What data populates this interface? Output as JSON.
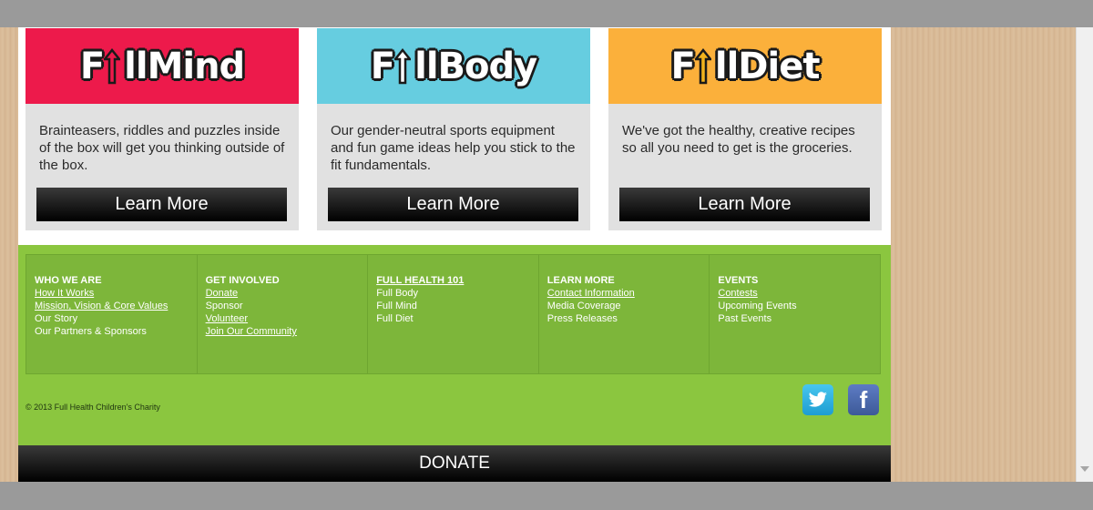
{
  "cards": [
    {
      "logo": "FullMind",
      "logo_prefix": "F",
      "logo_ll": "ll",
      "logo_suffix": "Mind",
      "head_color": "#ed1a4b",
      "arrow_color": "#ed1a4b",
      "text": "Brainteasers, riddles and puzzles inside of the box will get you thinking outside of the box.",
      "button": "Learn More"
    },
    {
      "logo": "FullBody",
      "logo_prefix": "F",
      "logo_ll": "ll",
      "logo_suffix": "Body",
      "head_color": "#66cde0",
      "arrow_color": "#66cde0",
      "text": "Our gender-neutral sports equipment and fun game ideas help you stick to the fit fundamentals.",
      "button": "Learn More"
    },
    {
      "logo": "FullDiet",
      "logo_prefix": "F",
      "logo_ll": "ll",
      "logo_suffix": "Diet",
      "head_color": "#fbb03b",
      "arrow_color": "#f2b31c",
      "text": "We've got the healthy, creative recipes so all you need to get is the groceries.",
      "button": "Learn More"
    }
  ],
  "footer": {
    "columns": [
      {
        "heading": "WHO WE ARE",
        "heading_link": false,
        "items": [
          {
            "label": "How It Works",
            "link": true
          },
          {
            "label": "Mission, Vision & Core Values",
            "link": true
          },
          {
            "label": "Our Story",
            "link": false
          },
          {
            "label": "Our Partners & Sponsors",
            "link": false
          }
        ]
      },
      {
        "heading": "GET INVOLVED",
        "heading_link": false,
        "items": [
          {
            "label": "Donate",
            "link": true
          },
          {
            "label": "Sponsor",
            "link": false
          },
          {
            "label": "Volunteer",
            "link": true
          },
          {
            "label": "Join Our Community",
            "link": true
          }
        ]
      },
      {
        "heading": "FULL HEALTH 101",
        "heading_link": true,
        "items": [
          {
            "label": "Full Body",
            "link": false
          },
          {
            "label": "Full Mind",
            "link": false
          },
          {
            "label": "Full Diet",
            "link": false
          }
        ]
      },
      {
        "heading": "LEARN MORE",
        "heading_link": false,
        "items": [
          {
            "label": "Contact Information",
            "link": true
          },
          {
            "label": "Media Coverage",
            "link": false
          },
          {
            "label": "Press Releases",
            "link": false
          }
        ]
      },
      {
        "heading": "EVENTS",
        "heading_link": false,
        "items": [
          {
            "label": "Contests",
            "link": true
          },
          {
            "label": "Upcoming Events",
            "link": false
          },
          {
            "label": "Past Events",
            "link": false
          }
        ]
      }
    ],
    "copyright": "© 2013 Full Health Children's Charity",
    "social": {
      "twitter_icon": "twitter-bird-icon",
      "facebook_icon": "facebook-f-icon",
      "facebook_glyph": "f"
    }
  },
  "donate_label": "DONATE",
  "colors": {
    "footer_green": "#8bc63f",
    "footer_grid_green": "#7db63a",
    "button_black": "#000000"
  }
}
